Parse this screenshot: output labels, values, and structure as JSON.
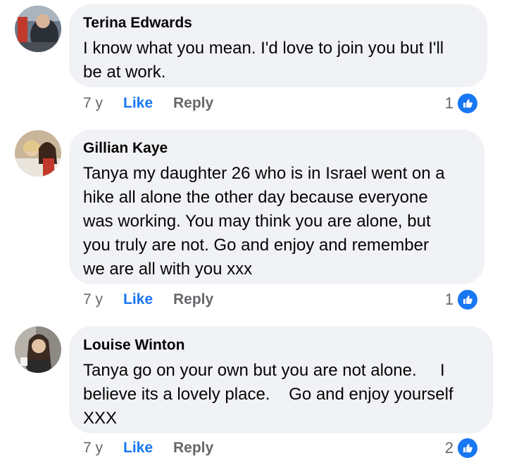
{
  "colors": {
    "accent": "#1877f2",
    "bubble": "#f0f2f5",
    "muted": "#65676b"
  },
  "comments": [
    {
      "author": "Terina Edwards",
      "text": "I know what you mean. I'd love to join you but I'll\nbe at work.",
      "age": "7 y",
      "like_label": "Like",
      "reply_label": "Reply",
      "reaction_count": "1",
      "reaction_icon": "thumbs-up-icon"
    },
    {
      "author": "Gillian Kaye",
      "text": "Tanya my daughter 26 who is in Israel went on a\nhike all alone the other day because everyone\nwas working. You may think you are alone, but\nyou truly are not. Go and enjoy and remember\nwe are all with you xxx",
      "age": "7 y",
      "like_label": "Like",
      "reply_label": "Reply",
      "reaction_count": "1",
      "reaction_icon": "thumbs-up-icon"
    },
    {
      "author": "Louise Winton",
      "text": "Tanya go on your own but you are not alone.     I\nbelieve its a lovely place.    Go and enjoy yourself\nXXX",
      "age": "7 y",
      "like_label": "Like",
      "reply_label": "Reply",
      "reaction_count": "2",
      "reaction_icon": "thumbs-up-icon"
    }
  ]
}
